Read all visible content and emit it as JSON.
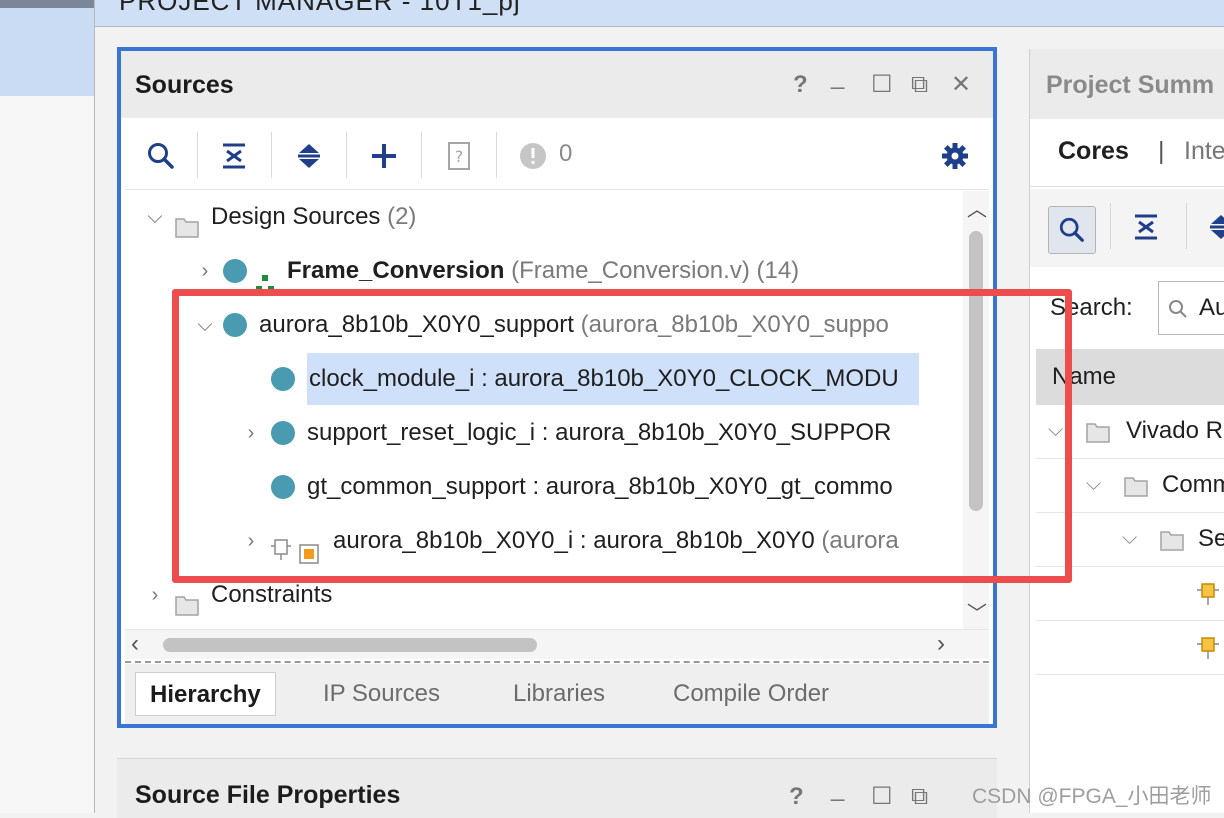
{
  "window": {
    "title": "PROJECT MANAGER - 10T1_pj"
  },
  "sources_panel": {
    "title": "Sources",
    "controls": {
      "help": "?",
      "minimize": "_",
      "maximize": "☐",
      "float": "⧉",
      "close": "✕"
    },
    "toolbar": {
      "search_icon": "search-icon",
      "collapse_all_icon": "collapse-all-icon",
      "expand_all_icon": "expand-all-icon",
      "add_icon": "add-icon",
      "unknown_icon": "question-file-icon",
      "count": "0",
      "settings_icon": "gear-icon"
    },
    "tree": [
      {
        "name": "Design Sources",
        "detail": "(2)"
      },
      {
        "name": "Frame_Conversion",
        "detail": "(Frame_Conversion.v) (14)"
      },
      {
        "name": "aurora_8b10b_X0Y0_support",
        "detail": "(aurora_8b10b_X0Y0_suppo"
      },
      {
        "name": "clock_module_i : aurora_8b10b_X0Y0_CLOCK_MODU",
        "detail": ""
      },
      {
        "name": "support_reset_logic_i : aurora_8b10b_X0Y0_SUPPOR",
        "detail": ""
      },
      {
        "name": "gt_common_support : aurora_8b10b_X0Y0_gt_commo",
        "detail": ""
      },
      {
        "name": "aurora_8b10b_X0Y0_i : aurora_8b10b_X0Y0",
        "detail": "(aurora"
      },
      {
        "name": "Constraints",
        "detail": ""
      }
    ],
    "tabs": [
      "Hierarchy",
      "IP Sources",
      "Libraries",
      "Compile Order"
    ]
  },
  "project_summary": {
    "title": "Project Summ",
    "tabs": [
      "Cores",
      "|",
      "Inte"
    ],
    "search_label": "Search:",
    "search_value": "Au",
    "column_header": "Name",
    "rows": [
      "Vivado R",
      "Comm",
      "Se"
    ]
  },
  "source_file_properties": {
    "title": "Source File Properties"
  },
  "watermark": "CSDN @FPGA_小田老师",
  "colors": {
    "accent": "#3a74d4",
    "highlight": "#ee4d4d",
    "selection": "#cfe0fa",
    "status_dot": "#4a9bb1"
  }
}
